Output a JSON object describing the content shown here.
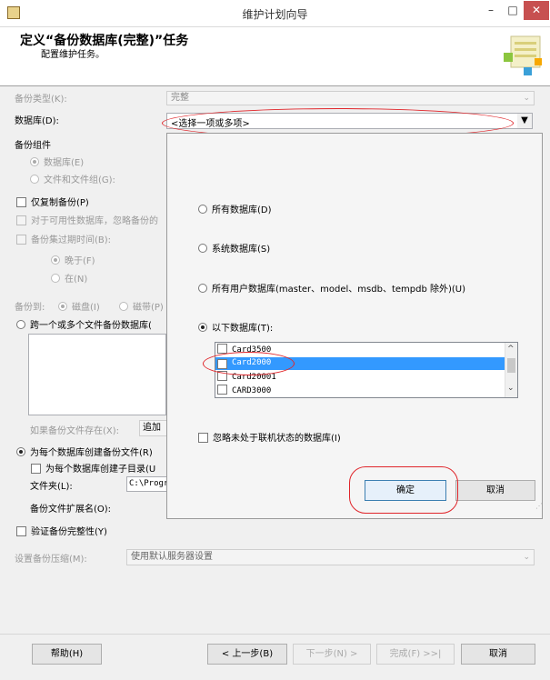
{
  "window": {
    "title": "维护计划向导",
    "min_glyph": "–",
    "max_glyph": "□",
    "close_glyph": "✕"
  },
  "header": {
    "title": "定义“备份数据库(完整)”任务",
    "subtitle": "配置维护任务。"
  },
  "form": {
    "backup_type_label": "备份类型(K):",
    "backup_type_value": "完整",
    "database_label": "数据库(D):",
    "database_value": "<选择一项或多项>",
    "backup_component_label": "备份组件",
    "component_database": "数据库(E)",
    "component_files": "文件和文件组(G):",
    "copy_only": "仅复制备份(P)",
    "availability_db": "对于可用性数据库，忽略备份的",
    "expire_label": "备份集过期时间(B):",
    "after_label": "晚于(F)",
    "on_label": "在(N)",
    "backup_to_label": "备份到:",
    "disk_label": "磁盘(I)",
    "tape_label": "磁带(P)",
    "across_files": "跨一个或多个文件备份数据库(",
    "if_exists_label": "如果备份文件存在(X):",
    "if_exists_value": "追加",
    "per_db_file": "为每个数据库创建备份文件(R)",
    "per_db_subdir": "为每个数据库创建子目录(U",
    "folder_label": "文件夹(L):",
    "folder_value": "C:\\Progr",
    "ext_label": "备份文件扩展名(O):",
    "verify": "验证备份完整性(Y)",
    "compression_label": "设置备份压缩(M):",
    "compression_value": "使用默认服务器设置"
  },
  "popup": {
    "option_all": "所有数据库(D)",
    "option_system": "系统数据库(S)",
    "option_user": "所有用户数据库(master、model、msdb、tempdb 除外)(U)",
    "option_these": "以下数据库(T):",
    "list": [
      "Card3500",
      "Card2000",
      "Card20001",
      "CARD3000"
    ],
    "ignore_offline": "忽略未处于联机状态的数据库(I)",
    "ok": "确定",
    "cancel": "取消"
  },
  "footer": {
    "help": "帮助(H)",
    "back": "< 上一步(B)",
    "next": "下一步(N) >",
    "finish": "完成(F) >>|",
    "cancel": "取消"
  },
  "colors": {
    "selection": "#3399ff",
    "annotation": "#e0262b",
    "close_button": "#c75050"
  }
}
